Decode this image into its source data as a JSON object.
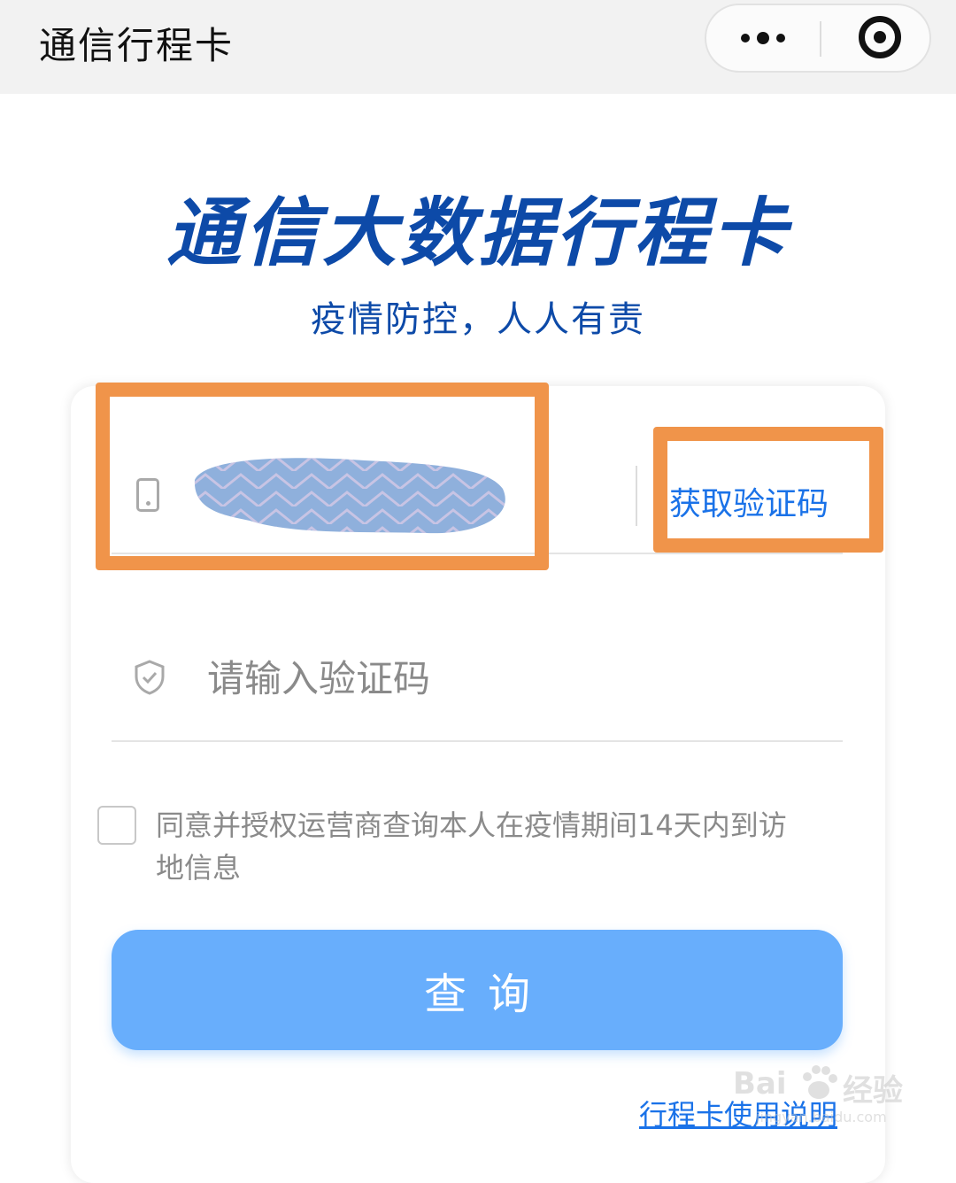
{
  "nav": {
    "title": "通信行程卡",
    "more_icon": "more-dots-icon",
    "close_icon": "target-close-icon"
  },
  "hero": {
    "title": "通信大数据行程卡",
    "subtitle": "疫情防控，人人有责"
  },
  "form": {
    "phone_icon": "phone-icon",
    "phone_value_redacted": true,
    "get_code_label": "获取验证码",
    "code_icon": "shield-check-icon",
    "code_placeholder": "请输入验证码",
    "consent_text": "同意并授权运营商查询本人在疫情期间14天内到访地信息",
    "consent_checked": false,
    "query_label": "查询",
    "help_link": "行程卡使用说明"
  },
  "watermark": {
    "brand": "Bai",
    "brand_suffix": "经验",
    "url": "jingyan.baidu.com"
  },
  "colors": {
    "brand_blue": "#0d4aa8",
    "link_blue": "#1a72e8",
    "button_blue": "#68aefc",
    "highlight_orange": "#f0944a"
  }
}
